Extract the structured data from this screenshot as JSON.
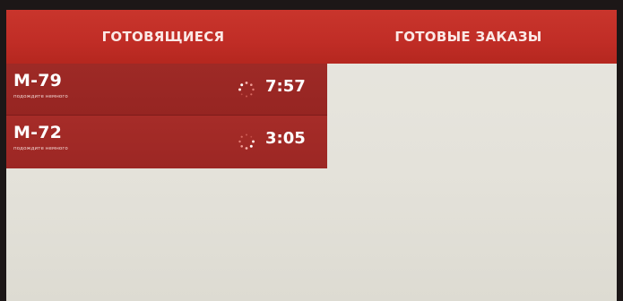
{
  "header": {
    "tab_preparing": "ГОТОВЯЩИЕСЯ",
    "tab_ready": "ГОТОВЫЕ ЗАКАЗЫ"
  },
  "orders": [
    {
      "code": "М-79",
      "hint": "подождите немного",
      "time": "7:57",
      "icon": "loading-spinner-icon"
    },
    {
      "code": "М-72",
      "hint": "подождите немного",
      "time": "3:05",
      "icon": "loading-spinner-icon"
    }
  ],
  "colors": {
    "header_red": "#c9352c",
    "row_red": "#9e2a26",
    "panel_background": "#e6e4dc"
  }
}
